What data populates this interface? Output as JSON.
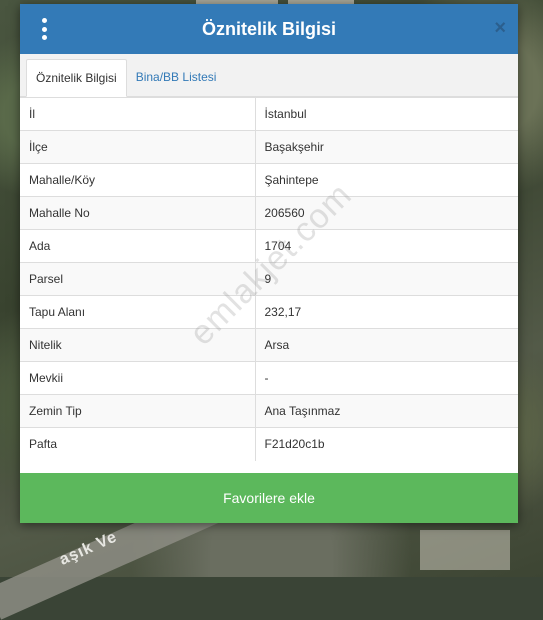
{
  "modal": {
    "title": "Öznitelik Bilgisi",
    "close_glyph": "×",
    "favorite_button": "Favorilere ekle"
  },
  "tabs": [
    {
      "label": "Öznitelik Bilgisi",
      "active": true
    },
    {
      "label": "Bina/BB Listesi",
      "active": false
    }
  ],
  "attributes": [
    {
      "key": "İl",
      "value": "İstanbul"
    },
    {
      "key": "İlçe",
      "value": "Başakşehir"
    },
    {
      "key": "Mahalle/Köy",
      "value": "Şahintepe"
    },
    {
      "key": "Mahalle No",
      "value": "206560"
    },
    {
      "key": "Ada",
      "value": "1704"
    },
    {
      "key": "Parsel",
      "value": "9"
    },
    {
      "key": "Tapu Alanı",
      "value": "232,17"
    },
    {
      "key": "Nitelik",
      "value": "Arsa"
    },
    {
      "key": "Mevkii",
      "value": "-"
    },
    {
      "key": "Zemin Tip",
      "value": "Ana Taşınmaz"
    },
    {
      "key": "Pafta",
      "value": "F21d20c1b"
    }
  ],
  "map": {
    "road_label": "aşık Ve"
  },
  "watermark": "emlakjet.com",
  "colors": {
    "header": "#337ab7",
    "button": "#5cb85c"
  }
}
